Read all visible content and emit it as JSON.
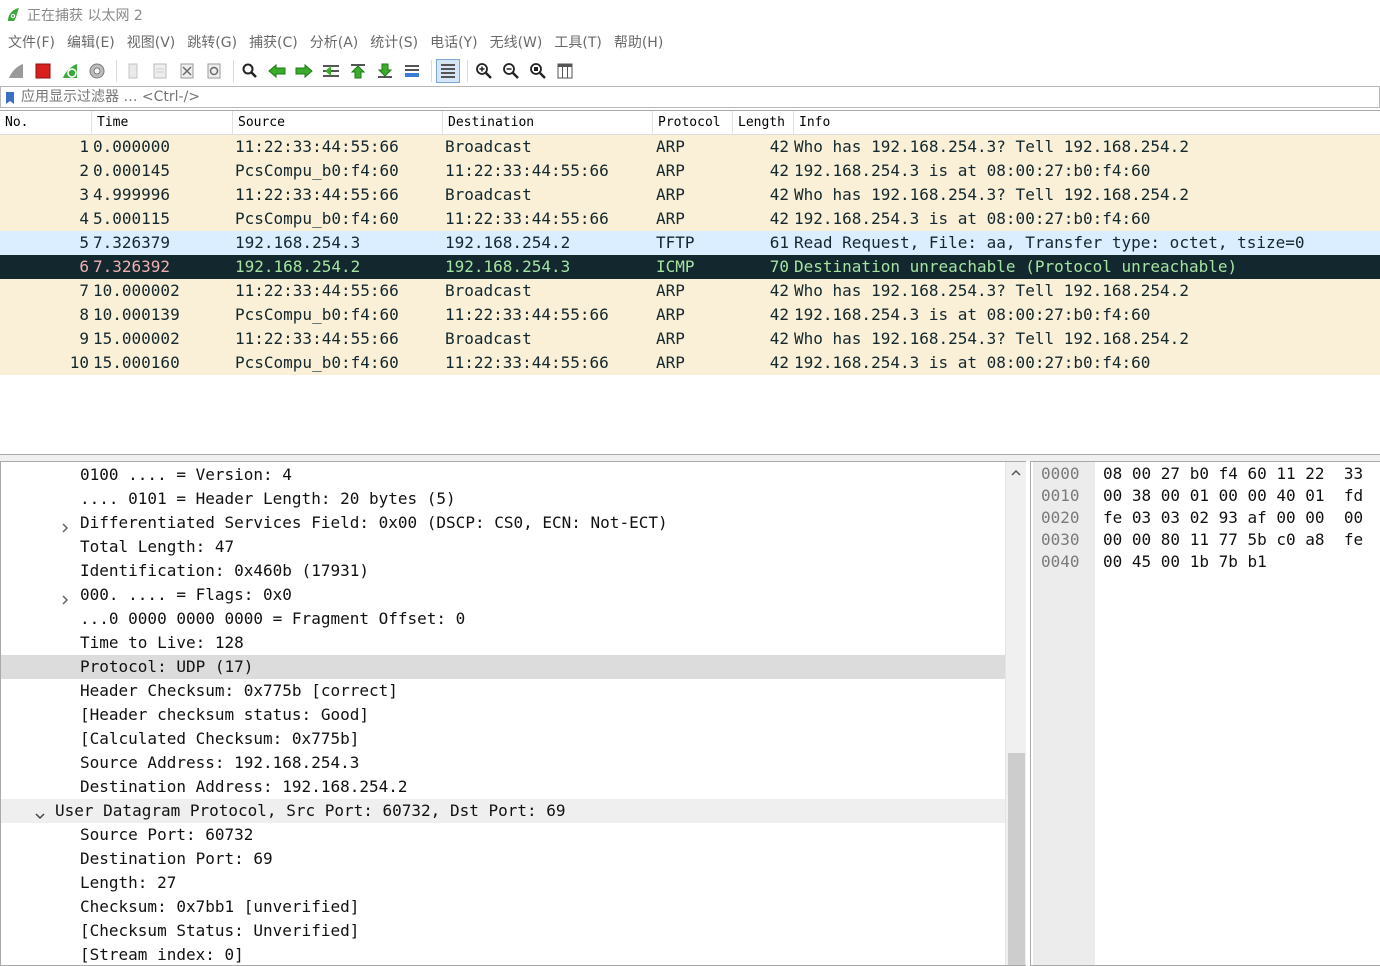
{
  "window": {
    "title": "正在捕获 以太网 2"
  },
  "menu": [
    "文件(F)",
    "编辑(E)",
    "视图(V)",
    "跳转(G)",
    "捕获(C)",
    "分析(A)",
    "统计(S)",
    "电话(Y)",
    "无线(W)",
    "工具(T)",
    "帮助(H)"
  ],
  "toolbar": {
    "buttons": [
      "shark-fin-start-icon",
      "stop-capture-icon",
      "restart-capture-icon",
      "capture-options-icon",
      "open-file-icon",
      "save-file-icon",
      "close-file-icon",
      "reload-file-icon",
      "find-packet-icon",
      "go-back-icon",
      "go-forward-icon",
      "go-to-packet-icon",
      "go-first-icon",
      "go-last-icon",
      "auto-scroll-icon",
      "colorize-icon",
      "zoom-in-icon",
      "zoom-out-icon",
      "zoom-normal-icon",
      "resize-columns-icon"
    ],
    "colors": {
      "stop": "#d9201c",
      "green": "#3aa83a",
      "arrow_green": "#3bab2c"
    }
  },
  "filter": {
    "placeholder": "应用显示过滤器 … <Ctrl-/>"
  },
  "packet_list": {
    "columns": [
      "No.",
      "Time",
      "Source",
      "Destination",
      "Protocol",
      "Length",
      "Info"
    ],
    "rows": [
      {
        "no": "1",
        "time": "0.000000",
        "source": "11:22:33:44:55:66",
        "destination": "Broadcast",
        "protocol": "ARP",
        "length": "42",
        "info": "Who has 192.168.254.3? Tell 192.168.254.2",
        "style": "arp"
      },
      {
        "no": "2",
        "time": "0.000145",
        "source": "PcsCompu_b0:f4:60",
        "destination": "11:22:33:44:55:66",
        "protocol": "ARP",
        "length": "42",
        "info": "192.168.254.3 is at 08:00:27:b0:f4:60",
        "style": "arp"
      },
      {
        "no": "3",
        "time": "4.999996",
        "source": "11:22:33:44:55:66",
        "destination": "Broadcast",
        "protocol": "ARP",
        "length": "42",
        "info": "Who has 192.168.254.3? Tell 192.168.254.2",
        "style": "arp"
      },
      {
        "no": "4",
        "time": "5.000115",
        "source": "PcsCompu_b0:f4:60",
        "destination": "11:22:33:44:55:66",
        "protocol": "ARP",
        "length": "42",
        "info": "192.168.254.3 is at 08:00:27:b0:f4:60",
        "style": "arp"
      },
      {
        "no": "5",
        "time": "7.326379",
        "source": "192.168.254.3",
        "destination": "192.168.254.2",
        "protocol": "TFTP",
        "length": "61",
        "info": "Read Request, File: aa, Transfer type: octet, tsize=0",
        "style": "udp"
      },
      {
        "no": "6",
        "time": "7.326392",
        "source": "192.168.254.2",
        "destination": "192.168.254.3",
        "protocol": "ICMP",
        "length": "70",
        "info": "Destination unreachable (Protocol unreachable)",
        "style": "error"
      },
      {
        "no": "7",
        "time": "10.000002",
        "source": "11:22:33:44:55:66",
        "destination": "Broadcast",
        "protocol": "ARP",
        "length": "42",
        "info": "Who has 192.168.254.3? Tell 192.168.254.2",
        "style": "arp"
      },
      {
        "no": "8",
        "time": "10.000139",
        "source": "PcsCompu_b0:f4:60",
        "destination": "11:22:33:44:55:66",
        "protocol": "ARP",
        "length": "42",
        "info": "192.168.254.3 is at 08:00:27:b0:f4:60",
        "style": "arp"
      },
      {
        "no": "9",
        "time": "15.000002",
        "source": "11:22:33:44:55:66",
        "destination": "Broadcast",
        "protocol": "ARP",
        "length": "42",
        "info": "Who has 192.168.254.3? Tell 192.168.254.2",
        "style": "arp"
      },
      {
        "no": "10",
        "time": "15.000160",
        "source": "PcsCompu_b0:f4:60",
        "destination": "11:22:33:44:55:66",
        "protocol": "ARP",
        "length": "42",
        "info": "192.168.254.3 is at 08:00:27:b0:f4:60",
        "style": "arp"
      }
    ],
    "row_colors": {
      "arp": {
        "bg": "#faf0d7",
        "fg": "#12272e"
      },
      "udp": {
        "bg": "#daeeff",
        "fg": "#12272e"
      },
      "error": {
        "bg": "#12272e",
        "fg": "#f78787",
        "fg_alt": "#f9e3a1"
      }
    }
  },
  "details": {
    "lines": [
      {
        "text": "0100 .... = Version: 4",
        "level": 2,
        "expander": "none",
        "highlight": ""
      },
      {
        "text": ".... 0101 = Header Length: 20 bytes (5)",
        "level": 2,
        "expander": "none",
        "highlight": ""
      },
      {
        "text": "Differentiated Services Field: 0x00 (DSCP: CS0, ECN: Not-ECT)",
        "level": 2,
        "expander": "collapsed",
        "highlight": ""
      },
      {
        "text": "Total Length: 47",
        "level": 2,
        "expander": "none",
        "highlight": ""
      },
      {
        "text": "Identification: 0x460b (17931)",
        "level": 2,
        "expander": "none",
        "highlight": ""
      },
      {
        "text": "000. .... = Flags: 0x0",
        "level": 2,
        "expander": "collapsed",
        "highlight": ""
      },
      {
        "text": "...0 0000 0000 0000 = Fragment Offset: 0",
        "level": 2,
        "expander": "none",
        "highlight": ""
      },
      {
        "text": "Time to Live: 128",
        "level": 2,
        "expander": "none",
        "highlight": ""
      },
      {
        "text": "Protocol: UDP (17)",
        "level": 2,
        "expander": "none",
        "highlight": "selected"
      },
      {
        "text": "Header Checksum: 0x775b [correct]",
        "level": 2,
        "expander": "none",
        "highlight": ""
      },
      {
        "text": "[Header checksum status: Good]",
        "level": 2,
        "expander": "none",
        "highlight": ""
      },
      {
        "text": "[Calculated Checksum: 0x775b]",
        "level": 2,
        "expander": "none",
        "highlight": ""
      },
      {
        "text": "Source Address: 192.168.254.3",
        "level": 2,
        "expander": "none",
        "highlight": ""
      },
      {
        "text": "Destination Address: 192.168.254.2",
        "level": 2,
        "expander": "none",
        "highlight": ""
      },
      {
        "text": "User Datagram Protocol, Src Port: 60732, Dst Port: 69",
        "level": 1,
        "expander": "expanded",
        "highlight": "parent"
      },
      {
        "text": "Source Port: 60732",
        "level": 2,
        "expander": "none",
        "highlight": ""
      },
      {
        "text": "Destination Port: 69",
        "level": 2,
        "expander": "none",
        "highlight": ""
      },
      {
        "text": "Length: 27",
        "level": 2,
        "expander": "none",
        "highlight": ""
      },
      {
        "text": "Checksum: 0x7bb1 [unverified]",
        "level": 2,
        "expander": "none",
        "highlight": ""
      },
      {
        "text": "[Checksum Status: Unverified]",
        "level": 2,
        "expander": "none",
        "highlight": ""
      },
      {
        "text": "[Stream index: 0]",
        "level": 2,
        "expander": "none",
        "highlight": ""
      }
    ]
  },
  "bytes": {
    "lines": [
      {
        "offset": "0000",
        "hex": "08 00 27 b0 f4 60 11 22  33"
      },
      {
        "offset": "0010",
        "hex": "00 38 00 01 00 00 40 01  fd"
      },
      {
        "offset": "0020",
        "hex": "fe 03 03 02 93 af 00 00  00"
      },
      {
        "offset": "0030",
        "hex": "00 00 80 11 77 5b c0 a8  fe"
      },
      {
        "offset": "0040",
        "hex": "00 45 00 1b 7b b1"
      }
    ]
  }
}
